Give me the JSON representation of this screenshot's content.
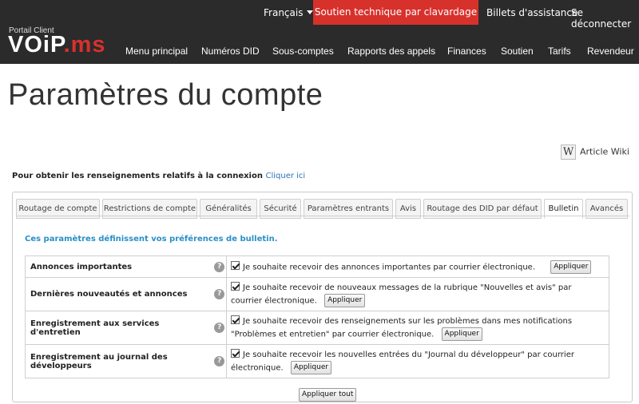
{
  "topbar": {
    "language": "Français",
    "support_chat": "Soutien technique par clavardage",
    "tickets": "Billets d'assistance",
    "logout": "Se déconnecter"
  },
  "brand": {
    "portal_label": "Portail Client",
    "logo_text_a": "VOiP",
    "logo_text_b": ".ms"
  },
  "nav": {
    "items": [
      "Menu principal",
      "Numéros DID",
      "Sous-comptes",
      "Rapports des appels",
      "Finances",
      "Soutien",
      "Tarifs",
      "Revendeur"
    ]
  },
  "page": {
    "title": "Paramètres du compte",
    "wiki_label": "Article Wiki",
    "login_info_text": "Pour obtenir les renseignements relatifs à la connexion",
    "login_info_link": "Cliquer ici"
  },
  "tabs": [
    "Routage de compte",
    "Restrictions de compte",
    "Généralités",
    "Sécurité",
    "Paramètres entrants",
    "Avis",
    "Routage des DID par défaut",
    "Bulletin",
    "Avancés"
  ],
  "active_tab": "Bulletin",
  "bulletin": {
    "intro": "Ces paramètres définissent vos préférences de bulletin.",
    "rows": [
      {
        "label": "Annonces importantes",
        "text": "Je souhaite recevoir des annonces importantes par courrier électronique.",
        "button": "Appliquer",
        "checked": true
      },
      {
        "label": "Dernières nouveautés et annonces",
        "text": "Je souhaite recevoir de nouveaux messages de la rubrique \"Nouvelles et avis\" par courrier électronique.",
        "button": "Appliquer",
        "checked": true
      },
      {
        "label": "Enregistrement aux services d'entretien",
        "text": "Je souhaite recevoir des renseignements sur les problèmes dans mes notifications \"Problèmes et entretien\" par courrier électronique.",
        "button": "Appliquer",
        "checked": true
      },
      {
        "label": "Enregistrement au journal des développeurs",
        "text": "Je souhaite recevoir les nouvelles entrées du \"Journal du développeur\" par courrier électronique.",
        "button": "Appliquer",
        "checked": true
      }
    ],
    "apply_all": "Appliquer tout"
  },
  "colors": {
    "header_bg": "#2b2b2b",
    "accent_red": "#d7312c",
    "link_blue": "#2a74b5",
    "intro_blue": "#2a8fc6"
  },
  "icons": {
    "help": "question-mark-icon",
    "wiki": "wikipedia-icon",
    "lang_caret": "caret-down-icon"
  }
}
